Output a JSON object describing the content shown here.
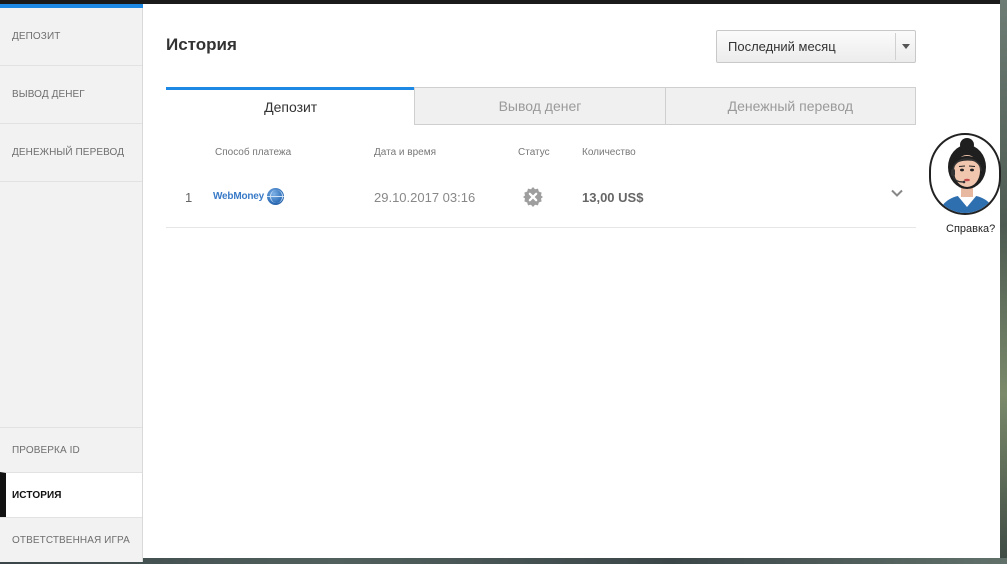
{
  "sidebar": {
    "top_items": [
      {
        "label": "ДЕПОЗИТ"
      },
      {
        "label": "ВЫВОД ДЕНЕГ"
      },
      {
        "label": "ДЕНЕЖНЫЙ ПЕРЕВОД"
      }
    ],
    "bottom_items": [
      {
        "label": "ПРОВЕРКА ID"
      },
      {
        "label": "ИСТОРИЯ"
      },
      {
        "label": "ОТВЕТСТВЕННАЯ ИГРА"
      }
    ],
    "active": "ИСТОРИЯ"
  },
  "main": {
    "title": "История",
    "period_select": {
      "value": "Последний месяц"
    },
    "tabs": [
      {
        "label": "Депозит",
        "active": true
      },
      {
        "label": "Вывод денег",
        "active": false
      },
      {
        "label": "Денежный перевод",
        "active": false
      }
    ],
    "table": {
      "headers": {
        "method": "Способ платежа",
        "datetime": "Дата и время",
        "status": "Статус",
        "amount": "Количество"
      },
      "rows": [
        {
          "index": "1",
          "method": "WebMoney",
          "datetime": "29.10.2017 03:16",
          "status_icon": "cancelled-x-icon",
          "amount": "13,00 US$"
        }
      ]
    }
  },
  "help": {
    "label": "Справка?"
  },
  "colors": {
    "accent": "#1e88e5",
    "sidebar_bg": "#f2f2f2",
    "status_icon": "#9e9e9e",
    "webmoney": "#3a7bc8"
  }
}
